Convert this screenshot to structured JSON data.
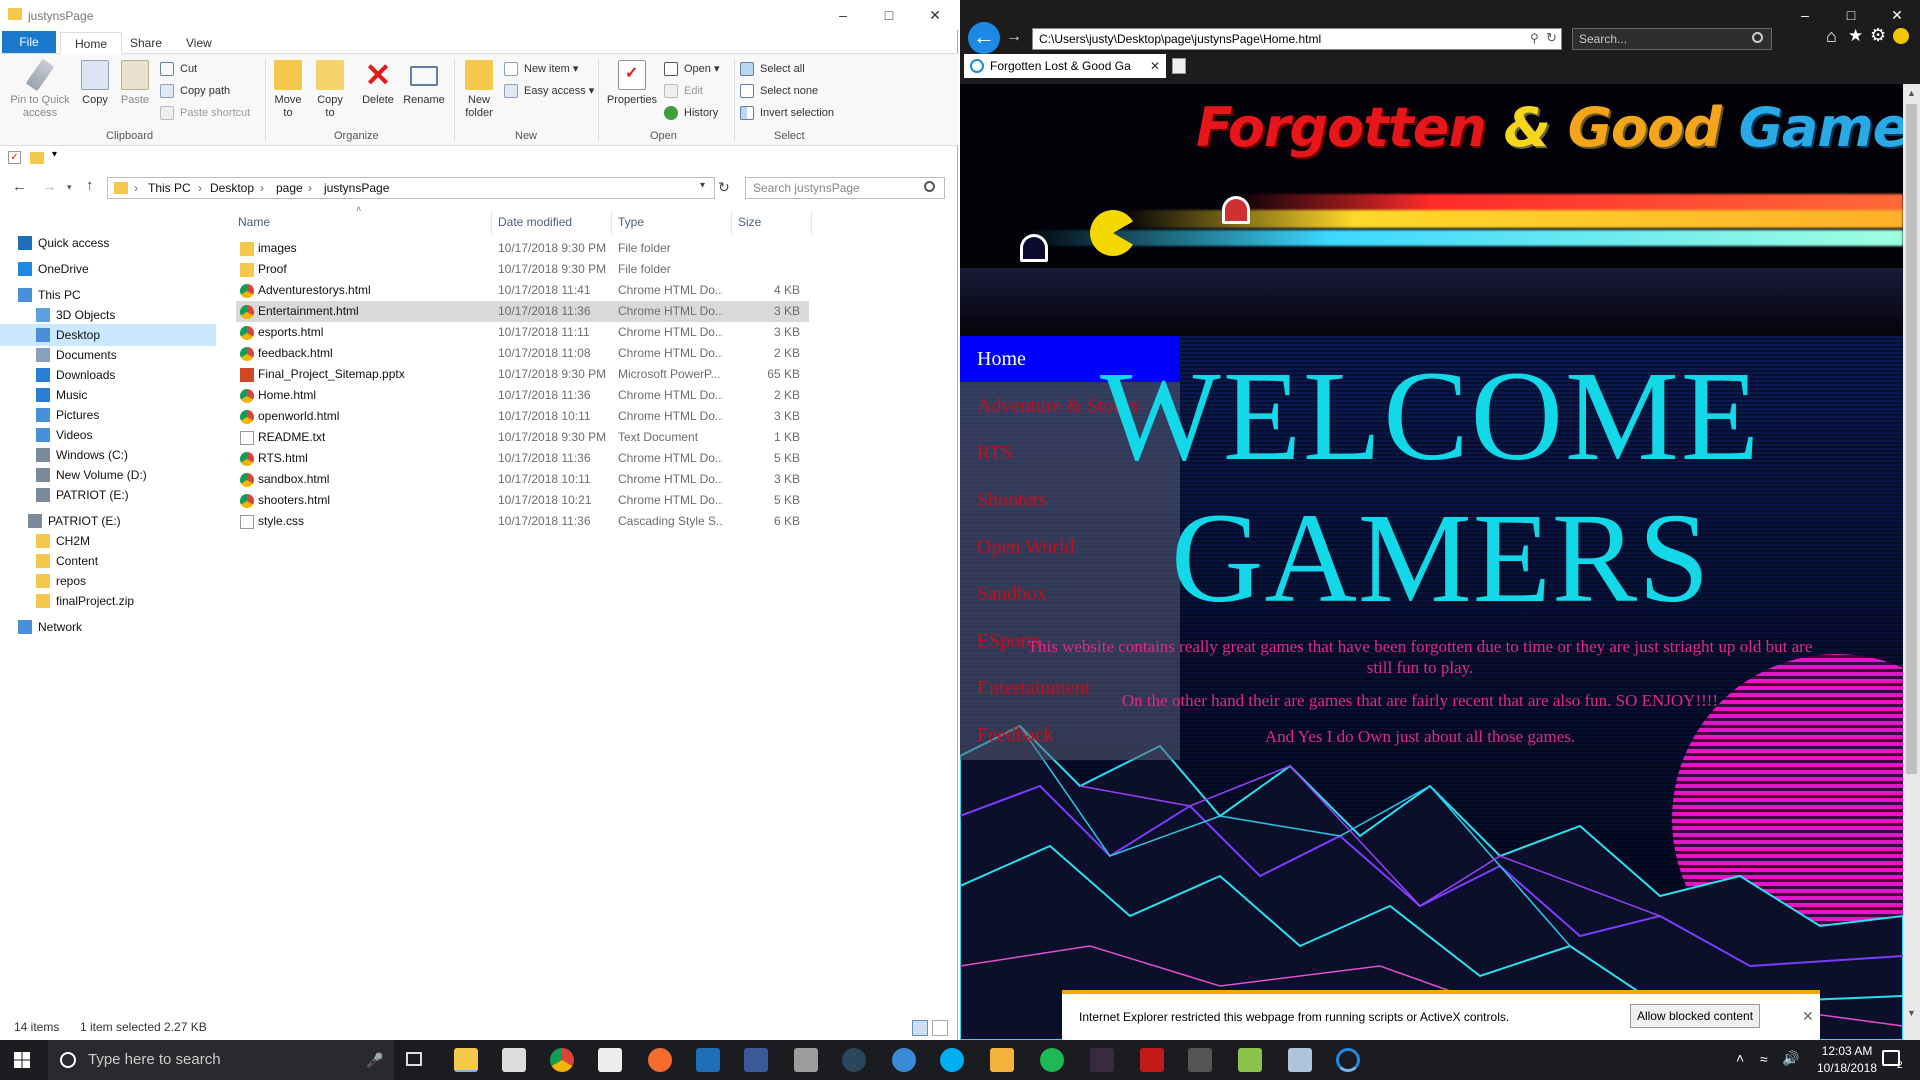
{
  "explorer": {
    "title": "justynsPage",
    "tabs": [
      "File",
      "Home",
      "Share",
      "View"
    ],
    "ribbon": {
      "clipboard": {
        "pin": "Pin to Quick access",
        "copy": "Copy",
        "paste": "Paste",
        "cut": "Cut",
        "copy_path": "Copy path",
        "paste_shortcut": "Paste shortcut",
        "label": "Clipboard"
      },
      "organize": {
        "move_to": "Move to",
        "copy_to": "Copy to",
        "delete": "Delete",
        "rename": "Rename",
        "label": "Organize"
      },
      "new": {
        "new_folder": "New folder",
        "new_item": "New item",
        "easy_access": "Easy access",
        "label": "New"
      },
      "open": {
        "properties": "Properties",
        "open": "Open",
        "edit": "Edit",
        "history": "History",
        "label": "Open"
      },
      "select": {
        "select_all": "Select all",
        "select_none": "Select none",
        "invert": "Invert selection",
        "label": "Select"
      }
    },
    "address": {
      "crumbs": [
        "This PC",
        "Desktop",
        "page",
        "justynsPage"
      ],
      "search_placeholder": "Search justynsPage"
    },
    "nav": [
      {
        "label": "Quick access"
      },
      {
        "label": "OneDrive"
      },
      {
        "label": "This PC"
      },
      {
        "label": "3D Objects"
      },
      {
        "label": "Desktop"
      },
      {
        "label": "Documents"
      },
      {
        "label": "Downloads"
      },
      {
        "label": "Music"
      },
      {
        "label": "Pictures"
      },
      {
        "label": "Videos"
      },
      {
        "label": "Windows (C:)"
      },
      {
        "label": "New Volume (D:)"
      },
      {
        "label": "PATRIOT (E:)"
      },
      {
        "label": "PATRIOT (E:)"
      },
      {
        "label": "CH2M"
      },
      {
        "label": "Content"
      },
      {
        "label": "repos"
      },
      {
        "label": "finalProject.zip"
      },
      {
        "label": "Network"
      }
    ],
    "columns": {
      "name": "Name",
      "date": "Date modified",
      "type": "Type",
      "size": "Size"
    },
    "files": [
      {
        "name": "images",
        "date": "10/17/2018 9:30 PM",
        "type": "File folder",
        "size": "",
        "kind": "folder"
      },
      {
        "name": "Proof",
        "date": "10/17/2018 9:30 PM",
        "type": "File folder",
        "size": "",
        "kind": "folder"
      },
      {
        "name": "Adventurestorys.html",
        "date": "10/17/2018 11:41",
        "type": "Chrome HTML Do...",
        "size": "4 KB",
        "kind": "chrome"
      },
      {
        "name": "Entertainment.html",
        "date": "10/17/2018 11:36",
        "type": "Chrome HTML Do...",
        "size": "3 KB",
        "kind": "chrome"
      },
      {
        "name": "esports.html",
        "date": "10/17/2018 11:11",
        "type": "Chrome HTML Do...",
        "size": "3 KB",
        "kind": "chrome"
      },
      {
        "name": "feedback.html",
        "date": "10/17/2018 11:08",
        "type": "Chrome HTML Do...",
        "size": "2 KB",
        "kind": "chrome"
      },
      {
        "name": "Final_Project_Sitemap.pptx",
        "date": "10/17/2018 9:30 PM",
        "type": "Microsoft PowerP...",
        "size": "65 KB",
        "kind": "pptx"
      },
      {
        "name": "Home.html",
        "date": "10/17/2018 11:36",
        "type": "Chrome HTML Do...",
        "size": "2 KB",
        "kind": "chrome"
      },
      {
        "name": "openworld.html",
        "date": "10/17/2018 10:11",
        "type": "Chrome HTML Do...",
        "size": "3 KB",
        "kind": "chrome"
      },
      {
        "name": "README.txt",
        "date": "10/17/2018 9:30 PM",
        "type": "Text Document",
        "size": "1 KB",
        "kind": "txt"
      },
      {
        "name": "RTS.html",
        "date": "10/17/2018 11:36",
        "type": "Chrome HTML Do...",
        "size": "5 KB",
        "kind": "chrome"
      },
      {
        "name": "sandbox.html",
        "date": "10/17/2018 10:11",
        "type": "Chrome HTML Do...",
        "size": "3 KB",
        "kind": "chrome"
      },
      {
        "name": "shooters.html",
        "date": "10/17/2018 10:21",
        "type": "Chrome HTML Do...",
        "size": "5 KB",
        "kind": "chrome"
      },
      {
        "name": "style.css",
        "date": "10/17/2018 11:36",
        "type": "Cascading Style S...",
        "size": "6 KB",
        "kind": "css"
      }
    ],
    "status": {
      "count": "14 items",
      "selected": "1 item selected  2.27 KB"
    }
  },
  "browser": {
    "url": "C:\\Users\\justy\\Desktop\\page\\justynsPage\\Home.html",
    "search_placeholder": "Search...",
    "tab_title": "Forgotten Lost & Good Ga",
    "page": {
      "logo": {
        "word1": "Forgotten",
        "amp": "&",
        "word2": "Good",
        "word3": "Games"
      },
      "nav": [
        "Home",
        "Adventure & Storys",
        "RTS",
        "Shooters",
        "Open World",
        "Sandbox",
        "ESports",
        "Entertainment",
        "Feedback"
      ],
      "hero1": "WELCOME",
      "hero2": "GAMERS",
      "p1": "This website contains really great games that have been forgotten due to time or they are just striaght up old but are still fun to play.",
      "p2": "On the other hand their are games that are fairly recent that are also fun. SO ENJOY!!!!",
      "p3": "And Yes I do Own just about all those games."
    },
    "notification": {
      "message": "Internet Explorer restricted this webpage from running scripts or ActiveX controls.",
      "button": "Allow blocked content"
    }
  },
  "taskbar": {
    "search_placeholder": "Type here to search",
    "time": "12:03 AM",
    "date": "10/18/2018",
    "notif_count": "2"
  },
  "colors": {
    "accent": "#1979ca",
    "hero_cyan": "#12d8e8",
    "nav_red": "#c30f1e",
    "text_pink": "#e6258a",
    "nav_home_blue": "#0000ff"
  }
}
